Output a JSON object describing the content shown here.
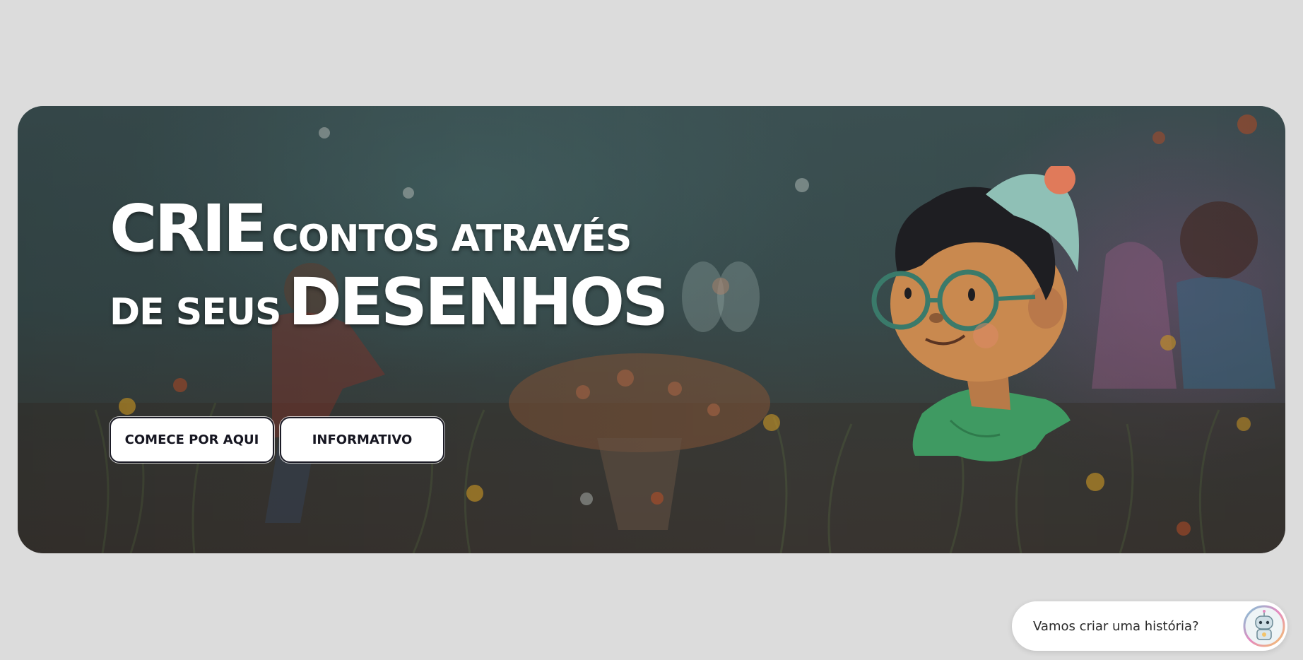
{
  "hero": {
    "headline": {
      "line1_big": "CRIE",
      "line1_small": "CONTOS ATRAVÉS",
      "line2_small": "DE SEUS",
      "line2_big": "DESENHOS"
    },
    "buttons": {
      "start_label": "COMECE POR AQUI",
      "info_label": "INFORMATIVO"
    },
    "character_icon": "boy-with-glasses-and-beanie-illustration",
    "background_icon": "fairy-garden-illustration"
  },
  "chat": {
    "prompt": "Vamos criar uma história?",
    "avatar_icon": "robot-avatar-icon"
  },
  "colors": {
    "page_background": "#dcdcdc",
    "hero_tint": "#3f5557",
    "button_background": "#ffffff",
    "button_border": "#1b1b26",
    "headline_text": "#ffffff"
  }
}
